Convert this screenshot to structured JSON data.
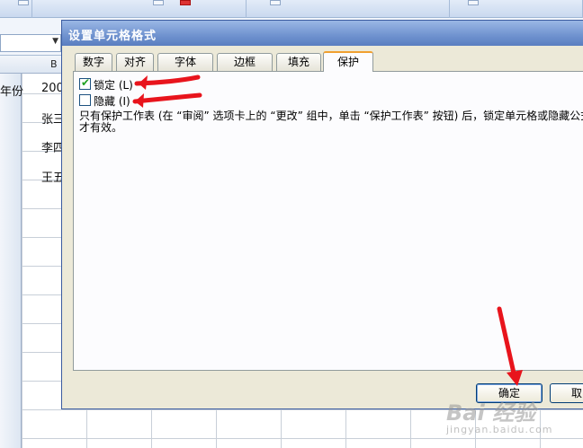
{
  "spreadsheet": {
    "column_letters": [
      "B"
    ],
    "cells": [
      "年份",
      "200",
      "张三",
      "李四",
      "王五"
    ]
  },
  "dialog": {
    "title": "设置单元格格式",
    "tabs": [
      {
        "label": "数字",
        "active": false
      },
      {
        "label": "对齐",
        "active": false
      },
      {
        "label": "字体",
        "active": false
      },
      {
        "label": "边框",
        "active": false
      },
      {
        "label": "填充",
        "active": false
      },
      {
        "label": "保护",
        "active": true
      }
    ],
    "protection": {
      "locked_label": "锁定 (L)",
      "locked_checked": true,
      "hidden_label": "隐藏 (I)",
      "hidden_checked": false,
      "description": "只有保护工作表 (在 “审阅” 选项卡上的 “更改” 组中，单击 “保护工作表” 按钮) 后，锁定单元格或隐藏公式才有效。"
    },
    "buttons": {
      "ok_label": "确定",
      "cancel_label": "取"
    }
  },
  "watermark": {
    "brand": "Bai 经验",
    "url": "jingyan.baidu.com"
  },
  "colors": {
    "title_bar": "#6f92cf",
    "dialog_bg": "#ece9d8",
    "active_tab_accent": "#f0a030",
    "checkmark": "#21a121",
    "arrow": "#e8141c"
  }
}
